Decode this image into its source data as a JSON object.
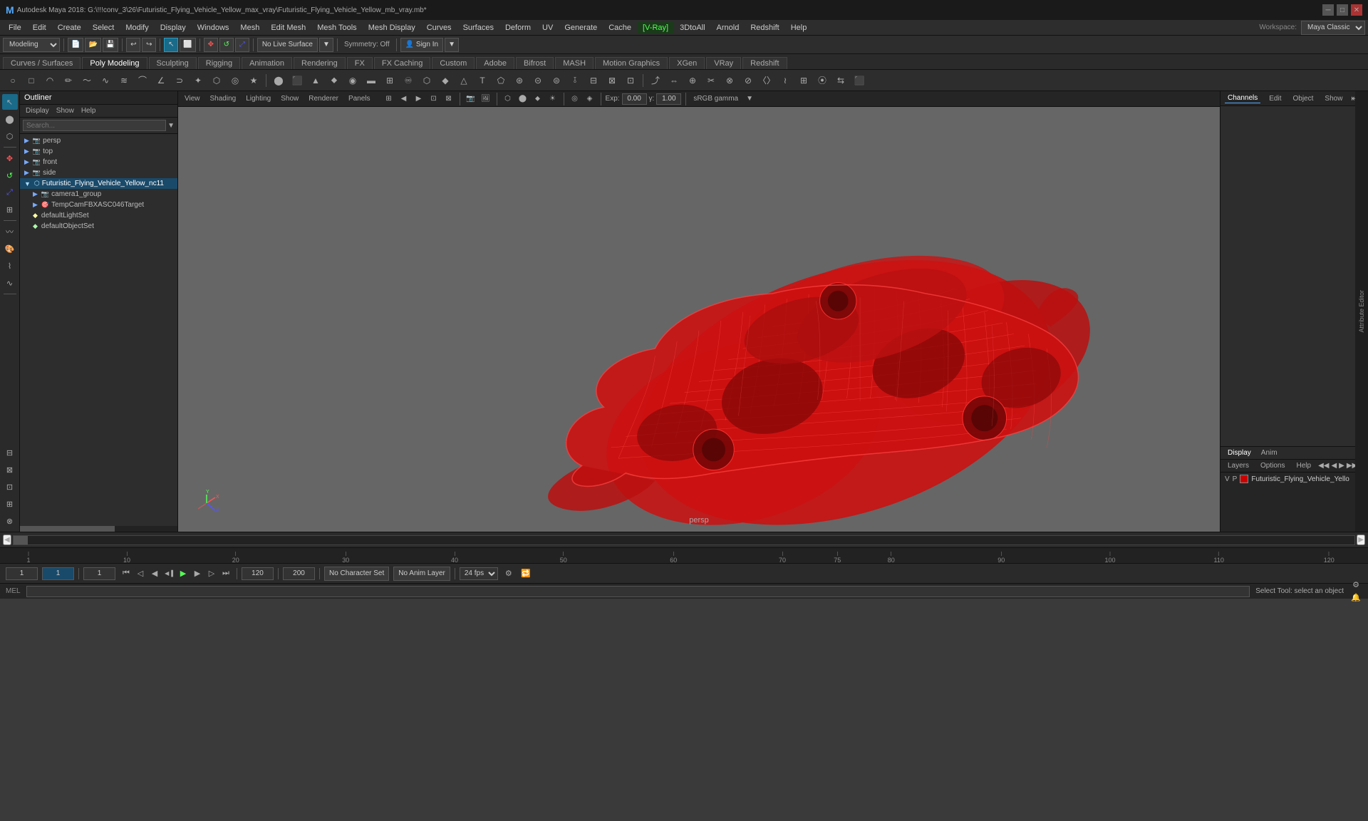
{
  "titlebar": {
    "title": "Autodesk Maya 2018: G:\\!!!conv_3\\26\\Futuristic_Flying_Vehicle_Yellow_max_vray\\Futuristic_Flying_Vehicle_Yellow_mb_vray.mb*",
    "logo": "M"
  },
  "menubar": {
    "items": [
      "File",
      "Edit",
      "Create",
      "Select",
      "Modify",
      "Display",
      "Windows",
      "Mesh",
      "Edit Mesh",
      "Mesh Tools",
      "Mesh Display",
      "Curves",
      "Surfaces",
      "Deform",
      "UV",
      "Generate",
      "Cache",
      "V-Ray",
      "3DtoAll",
      "Arnold",
      "Redshift",
      "Help"
    ]
  },
  "toolbar1": {
    "workspace_label": "Workspace:",
    "workspace_value": "Maya Classic",
    "mode_label": "Modeling"
  },
  "mode_tabs": {
    "items": [
      "Curves / Surfaces",
      "Poly Modeling",
      "Sculpting",
      "Rigging",
      "Animation",
      "Rendering",
      "FX",
      "FX Caching",
      "Custom",
      "Adobe",
      "Bifrost",
      "MASH",
      "Motion Graphics",
      "XGen",
      "VRay",
      "Redshift"
    ]
  },
  "no_live_surface": "No Live Surface",
  "symmetry_off": "Symmetry: Off",
  "viewport": {
    "menu_items": [
      "View",
      "Shading",
      "Lighting",
      "Show",
      "Renderer",
      "Panels"
    ],
    "gamma_label": "sRGB gamma",
    "exposure_value": "0.00",
    "gamma_value": "1.00",
    "camera_label": "persp"
  },
  "outliner": {
    "title": "Outliner",
    "menu_items": [
      "Display",
      "Show",
      "Help"
    ],
    "search_placeholder": "Search...",
    "items": [
      {
        "name": "persp",
        "type": "cam",
        "icon": "▶",
        "indent": 0
      },
      {
        "name": "top",
        "type": "cam",
        "icon": "▶",
        "indent": 0
      },
      {
        "name": "front",
        "type": "cam",
        "icon": "▶",
        "indent": 0
      },
      {
        "name": "side",
        "type": "cam",
        "icon": "▶",
        "indent": 0
      },
      {
        "name": "Futuristic_Flying_Vehicle_Yellow_nc11",
        "type": "mesh",
        "icon": "▼",
        "indent": 0
      },
      {
        "name": "camera1_group",
        "type": "cam",
        "icon": "▶",
        "indent": 1
      },
      {
        "name": "TempCamFBXASC046Target",
        "type": "cam",
        "icon": "▶",
        "indent": 1
      },
      {
        "name": "defaultLightSet",
        "type": "light",
        "icon": "◆",
        "indent": 1
      },
      {
        "name": "defaultObjectSet",
        "type": "set",
        "icon": "◆",
        "indent": 1
      }
    ]
  },
  "channels": {
    "tabs": [
      "Channels",
      "Edit",
      "Object",
      "Show"
    ],
    "layer_tabs": [
      "Display",
      "Anim"
    ],
    "layer_subtabs": [
      "Layers",
      "Options",
      "Help"
    ],
    "layer_item": {
      "v": "V",
      "p": "P",
      "color": "#cc0000",
      "name": "Futuristic_Flying_Vehicle_Yello"
    }
  },
  "timeline": {
    "start": "1",
    "end": "120",
    "anim_end": "200",
    "current": "1",
    "ticks": [
      "1",
      "10",
      "20",
      "30",
      "40",
      "50",
      "60",
      "70",
      "75",
      "80",
      "90",
      "100",
      "110",
      "120"
    ],
    "fps": "24 fps"
  },
  "bottom_controls": {
    "frame_start": "1",
    "frame_current": "1",
    "range_start": "1",
    "range_end": "120",
    "anim_end": "200",
    "no_character_set": "No Character Set",
    "no_anim_layer": "No Anim Layer"
  },
  "status_bar": {
    "mode": "MEL",
    "text": "Select Tool: select an object"
  },
  "icons": {
    "select": "↖",
    "move": "✥",
    "rotate": "↺",
    "scale": "⤢",
    "pan": "✋",
    "camera": "📷",
    "play": "▶",
    "prev_frame": "◀",
    "next_frame": "▶",
    "first_frame": "⏮",
    "last_frame": "⏭",
    "prev_key": "◁",
    "next_key": "▷"
  }
}
